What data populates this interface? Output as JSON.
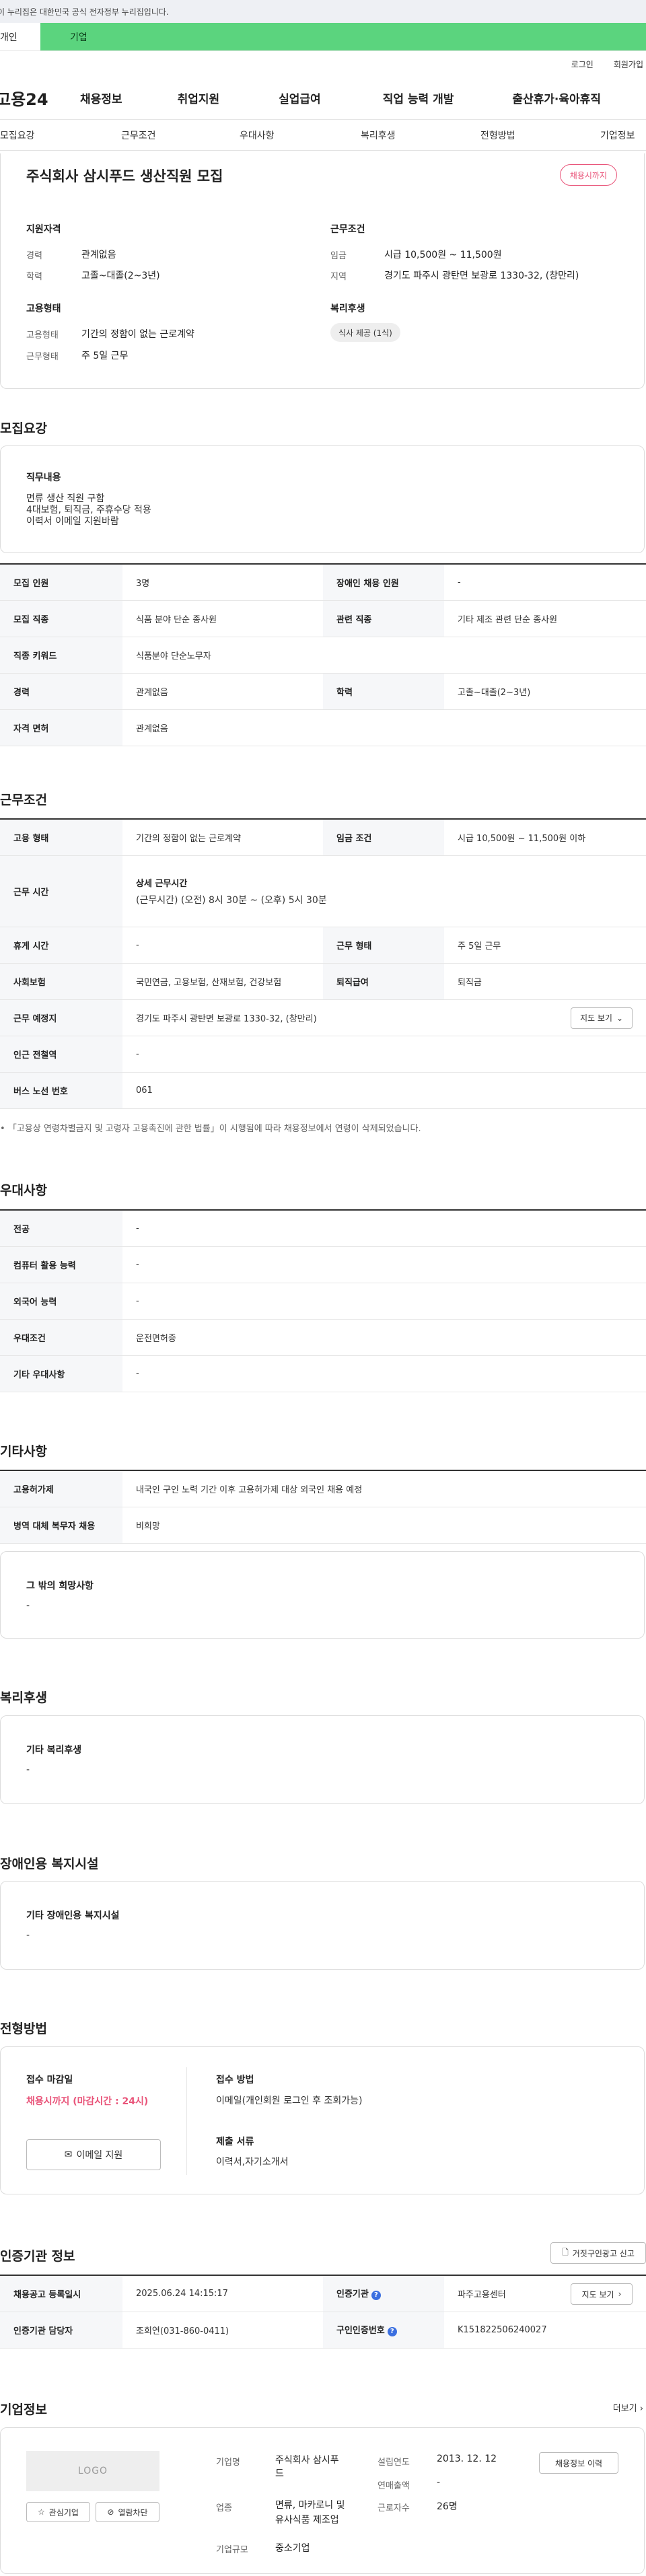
{
  "gov_banner": "이 누리집은 대한민국 공식 전자정부 누리집입니다.",
  "user_tabs": [
    "개인",
    "기업"
  ],
  "utility_links": [
    "로그인",
    "회원가입"
  ],
  "logo": "고용24",
  "gnb": [
    "채용정보",
    "취업지원",
    "실업급여",
    "직업 능력 개발",
    "출산휴가·육아휴직"
  ],
  "anchor_tabs": [
    "모집요강",
    "근무조건",
    "우대사항",
    "복리후생",
    "전형방법",
    "기업정보"
  ],
  "summary": {
    "title": "주식회사 삼시푸드 생산직원 모집",
    "badge": "채용시까지",
    "qual_title": "지원자격",
    "career_label": "경력",
    "career_value": "관계없음",
    "edu_label": "학력",
    "edu_value": "고졸~대졸(2~3년)",
    "cond_title": "근무조건",
    "wage_label": "임금",
    "wage_value": "시급 10,500원 ~ 11,500원",
    "region_label": "지역",
    "region_value": "경기도 파주시 광탄면 보광로 1330-32, (창만리)",
    "emp_title": "고용형태",
    "emp_label": "고용형태",
    "emp_value": "기간의 정함이 없는 근로계약",
    "workday_label": "근무형태",
    "workday_value": "주 5일 근무",
    "welfare_title": "복리후생",
    "welfare_chip": "식사 제공 (1식)"
  },
  "recruit": {
    "section": "모집요강",
    "duty_title": "직무내용",
    "duty_text": [
      "면류 생산 직원 구함",
      "4대보험, 퇴직금, 주휴수당 적용",
      "이력서 이메일 지원바람"
    ],
    "rows": [
      [
        "모집 인원",
        "3명",
        "장애인 채용 인원",
        "-"
      ],
      [
        "모집 직종",
        "식품 분야 단순 종사원",
        "관련 직종",
        "기타 제조 관련 단순 종사원"
      ],
      [
        "직종 키워드",
        "식품분야 단순노무자"
      ],
      [
        "경력",
        "관계없음",
        "학력",
        "고졸~대졸(2~3년)"
      ],
      [
        "자격 면허",
        "관계없음"
      ]
    ]
  },
  "conditions": {
    "section": "근무조건",
    "emp_type_label": "고용 형태",
    "emp_type_value": "기간의 정함이 없는 근로계약",
    "wage_label": "임금 조건",
    "wage_value": "시급 10,500원 ~ 11,500원 이하",
    "hours_label": "근무 시간",
    "hours_detail_title": "상세 근무시간",
    "hours_detail": "(근무시간) (오전) 8시 30분 ~ (오후) 5시 30분",
    "rest_label": "휴게 시간",
    "rest_value": "-",
    "work_type_label": "근무 형태",
    "work_type_value": "주 5일 근무",
    "insurance_label": "사회보험",
    "insurance_value": "국민연금, 고용보험, 산재보험, 건강보험",
    "severance_label": "퇴직급여",
    "severance_value": "퇴직금",
    "location_label": "근무 예정지",
    "location_value": "경기도 파주시 광탄면 보광로 1330-32, (창만리)",
    "map_button": "지도 보기",
    "subway_label": "인근 전철역",
    "subway_value": "-",
    "bus_label": "버스 노선 번호",
    "bus_value": "061",
    "note": "「고용상 연령차별금지 및 고령자 고용촉진에 관한 법률」이 시행됨에 따라 채용정보에서 연령이 삭제되었습니다."
  },
  "preference": {
    "section": "우대사항",
    "rows": [
      [
        "전공",
        "-"
      ],
      [
        "컴퓨터 활용 능력",
        "-"
      ],
      [
        "외국어 능력",
        "-"
      ],
      [
        "우대조건",
        "운전면허증"
      ],
      [
        "기타 우대사항",
        "-"
      ]
    ]
  },
  "etc": {
    "section": "기타사항",
    "rows": [
      [
        "고용허가제",
        "내국인 구인 노력 기간 이후 고용허가제 대상 외국인 채용 예정"
      ],
      [
        "병역 대체 복무자 채용",
        "비희망"
      ]
    ],
    "other_title": "그 밖의 희망사항",
    "other_value": "-"
  },
  "welfare": {
    "section": "복리후생",
    "title": "기타 복리후생",
    "value": "-"
  },
  "disabled": {
    "section": "장애인용 복지시설",
    "title": "기타 장애인용 복지시설",
    "value": "-"
  },
  "process": {
    "section": "전형방법",
    "deadline_title": "접수 마감일",
    "deadline_value": "채용시까지 (마감시간 : 24시)",
    "email_button": "이메일 지원",
    "method_title": "접수 방법",
    "method_value": "이메일(개인회원 로그인 후 조회가능)",
    "docs_title": "제출 서류",
    "docs_value": "이력서,자기소개서"
  },
  "cert": {
    "section": "인증기관 정보",
    "report_button": "거짓구인광고 신고",
    "reg_date_label": "채용공고 등록일시",
    "reg_date_value": "2025.06.24 14:15:17",
    "agency_label": "인증기관",
    "agency_value": "파주고용센터",
    "manager_label": "인증기관 담당자",
    "manager_value": "조희연(031-860-0411)",
    "number_label": "구인인증번호",
    "number_value": "K151822506240027",
    "map_button": "지도 보기"
  },
  "company": {
    "section": "기업정보",
    "more": "더보기",
    "logo_text": "LOGO",
    "interest_button": "관심기업",
    "block_button": "열람차단",
    "name_label": "기업명",
    "name_value": [
      "주식회사 삼시푸",
      "드"
    ],
    "industry_label": "업종",
    "industry_value": [
      "면류, 마카로니 및",
      "유사식품 제조업"
    ],
    "size_label": "기업규모",
    "size_value": "중소기업",
    "founded_label": "설립연도",
    "founded_value": "2013. 12. 12",
    "revenue_label": "연매출액",
    "revenue_value": "-",
    "employees_label": "근로자수",
    "employees_value": "26명",
    "jobs_button": "채용정보 이력"
  }
}
